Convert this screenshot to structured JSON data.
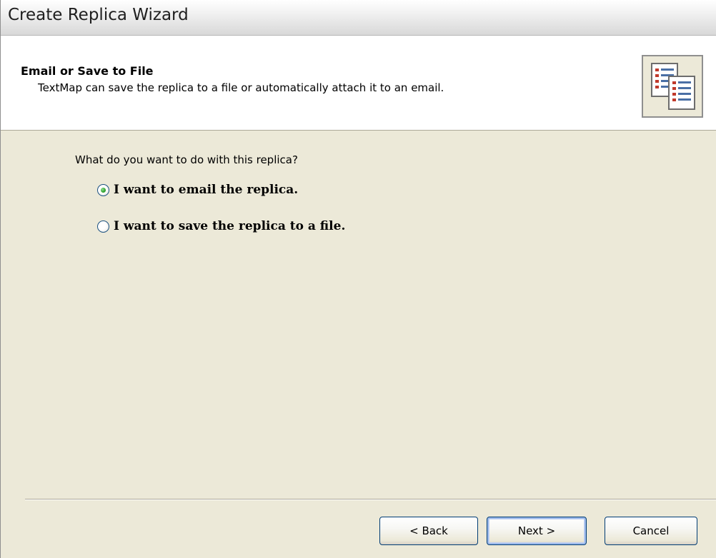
{
  "window": {
    "title": "Create Replica Wizard"
  },
  "header": {
    "title": "Email or Save to File",
    "subtitle": "TextMap can save the replica to a file or automatically attach it to an email.",
    "icon": "replica-documents-icon"
  },
  "body": {
    "question": "What do you want to do with this replica?",
    "options": [
      {
        "label": "I want to email the replica.",
        "selected": true
      },
      {
        "label": "I want to save the replica to a file.",
        "selected": false
      }
    ]
  },
  "buttons": {
    "back_label": "< Back",
    "next_label": "Next >",
    "cancel_label": "Cancel"
  },
  "colors": {
    "panel_background": "#ece9d8",
    "header_background": "#ffffff",
    "radio_selected": "#2fa22f",
    "default_button_focus": "#9cb9ea"
  }
}
